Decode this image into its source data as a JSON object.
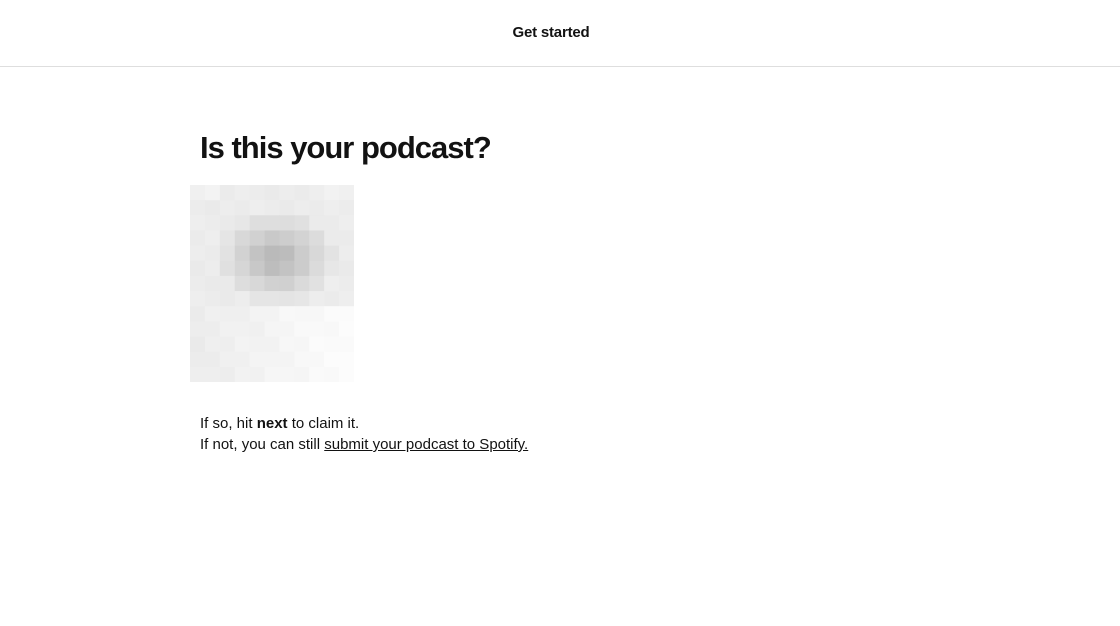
{
  "header": {
    "title": "Get started"
  },
  "main": {
    "heading": "Is this your podcast?",
    "cover_image": {
      "icon": "podcast-cover-image",
      "state": "pixelated"
    },
    "message": {
      "line1_before": "If so, hit ",
      "line1_bold": "next",
      "line1_after": " to claim it.",
      "line2_before": "If not, you can still ",
      "line2_link": "submit your podcast to Spotify."
    }
  }
}
